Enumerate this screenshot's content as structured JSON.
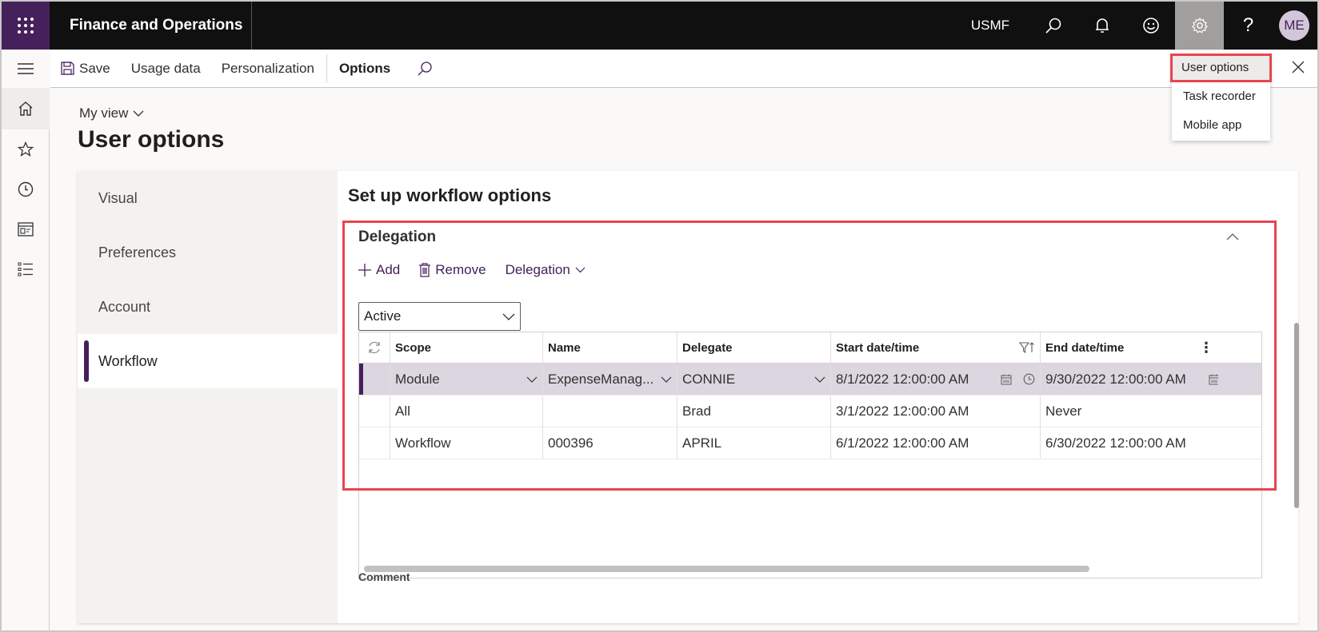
{
  "app": {
    "title": "Finance and Operations",
    "company": "USMF",
    "avatar_initials": "ME",
    "accent_color": "#45205a",
    "highlight_color": "#e8444f"
  },
  "topbar_icons": [
    "search-icon",
    "bell-icon",
    "smiley-icon",
    "gear-icon",
    "help-icon"
  ],
  "actionbar": {
    "save": "Save",
    "usage_data": "Usage data",
    "personalization": "Personalization",
    "options": "Options"
  },
  "settings_menu": {
    "items": [
      {
        "label": "User options"
      },
      {
        "label": "Task recorder"
      },
      {
        "label": "Mobile app"
      }
    ],
    "selected": "User options"
  },
  "page": {
    "view_selector": "My view",
    "title": "User options"
  },
  "tabs": [
    {
      "label": "Visual"
    },
    {
      "label": "Preferences"
    },
    {
      "label": "Account"
    },
    {
      "label": "Workflow",
      "active": true
    }
  ],
  "workflow": {
    "section_title": "Set up workflow options",
    "fasttab_title": "Delegation",
    "toolbar": {
      "add": "Add",
      "remove": "Remove",
      "delegation": "Delegation"
    },
    "filter": {
      "value": "Active"
    },
    "grid": {
      "columns": [
        "Scope",
        "Name",
        "Delegate",
        "Start date/time",
        "End date/time"
      ],
      "rows": [
        {
          "scope": "Module",
          "name": "ExpenseManag...",
          "delegate": "CONNIE",
          "start": "8/1/2022 12:00:00 AM",
          "end": "9/30/2022 12:00:00 AM",
          "selected": true
        },
        {
          "scope": "All",
          "name": "",
          "delegate": "Brad",
          "start": "3/1/2022 12:00:00 AM",
          "end": "Never"
        },
        {
          "scope": "Workflow",
          "name": "000396",
          "delegate": "APRIL",
          "start": "6/1/2022 12:00:00 AM",
          "end": "6/30/2022 12:00:00 AM"
        }
      ]
    },
    "comment_label": "Comment"
  }
}
